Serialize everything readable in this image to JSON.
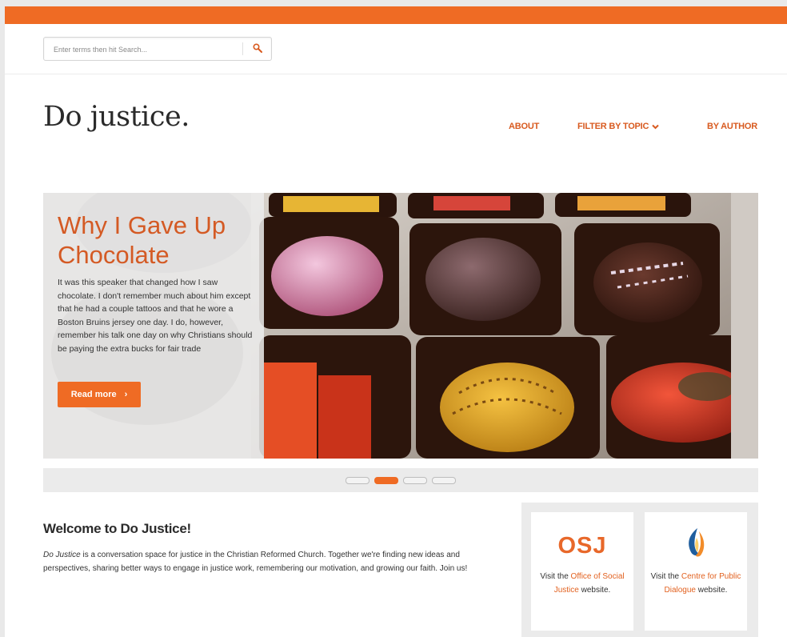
{
  "search": {
    "placeholder": "Enter terms then hit Search..."
  },
  "site": {
    "logo": "Do justice."
  },
  "nav": {
    "about": "ABOUT",
    "filter_by_topic": "FILTER BY TOPIC",
    "by_author": "BY AUTHOR"
  },
  "hero": {
    "headline": "Why I Gave Up Chocolate",
    "excerpt": "It was this speaker that changed how I saw chocolate. I don't remember much about him except that he had a couple tattoos and that he wore a Boston Bruins jersey one day. I do, however, remember his talk one day on why Christians should be paying the extra bucks for fair trade",
    "read_more": "Read more",
    "slides_total": 4,
    "active_slide": 2
  },
  "welcome": {
    "title": "Welcome to Do Justice!",
    "body_italic": "Do Justice",
    "body": " is a conversation space for justice in the Christian Reformed Church. Together we're finding new ideas and perspectives, sharing better ways to engage in justice work, remembering our motivation, and growing our faith. Join us!"
  },
  "partners": {
    "osj": {
      "logo_text": "OSJ",
      "pre": "Visit the ",
      "link": "Office of Social Justice",
      "post": " website."
    },
    "cpd": {
      "pre": "Visit the ",
      "link": "Centre for Public Dialogue",
      "post": " website."
    }
  },
  "colors": {
    "accent": "#ef6b24",
    "link": "#d85a1f"
  },
  "icons": [
    "search-icon",
    "chevron-down-icon",
    "chevron-right-icon",
    "flame-logo-icon"
  ]
}
